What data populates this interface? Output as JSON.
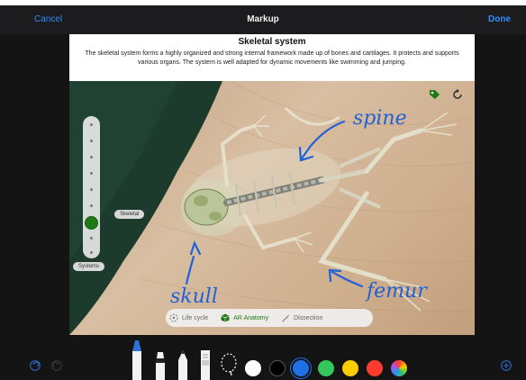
{
  "nav": {
    "cancel": "Cancel",
    "title": "Markup",
    "done": "Done"
  },
  "doc": {
    "title": "Skeletal system",
    "description": "The skeletal system forms a highly organized and strong internal framework made up of bones and cartilages. It protects and supports various organs. The system is well adapted for dynamic movements like swimming and jumping."
  },
  "annotations": {
    "spine": "spine",
    "skull": "skull",
    "femur": "femur"
  },
  "slider": {
    "level_label": "Skeletal",
    "bottom_label": "Systems",
    "dot_count": 9,
    "selected_index": 6
  },
  "segment": {
    "items": [
      "Life cycle",
      "AR Anatomy",
      "Dissection"
    ],
    "active": "AR Anatomy"
  },
  "icons": {
    "tag": "tag-icon",
    "refresh": "refresh-icon",
    "undo": "undo-icon",
    "redo": "redo-icon",
    "add": "add-icon"
  },
  "colors": {
    "accent": "#2f8cff",
    "active_green": "#1f7a16",
    "swatches": [
      "#ffffff",
      "#000000",
      "#1f6fe5",
      "#34c759",
      "#ffcc00",
      "#ff3b30",
      "multicolor"
    ]
  }
}
